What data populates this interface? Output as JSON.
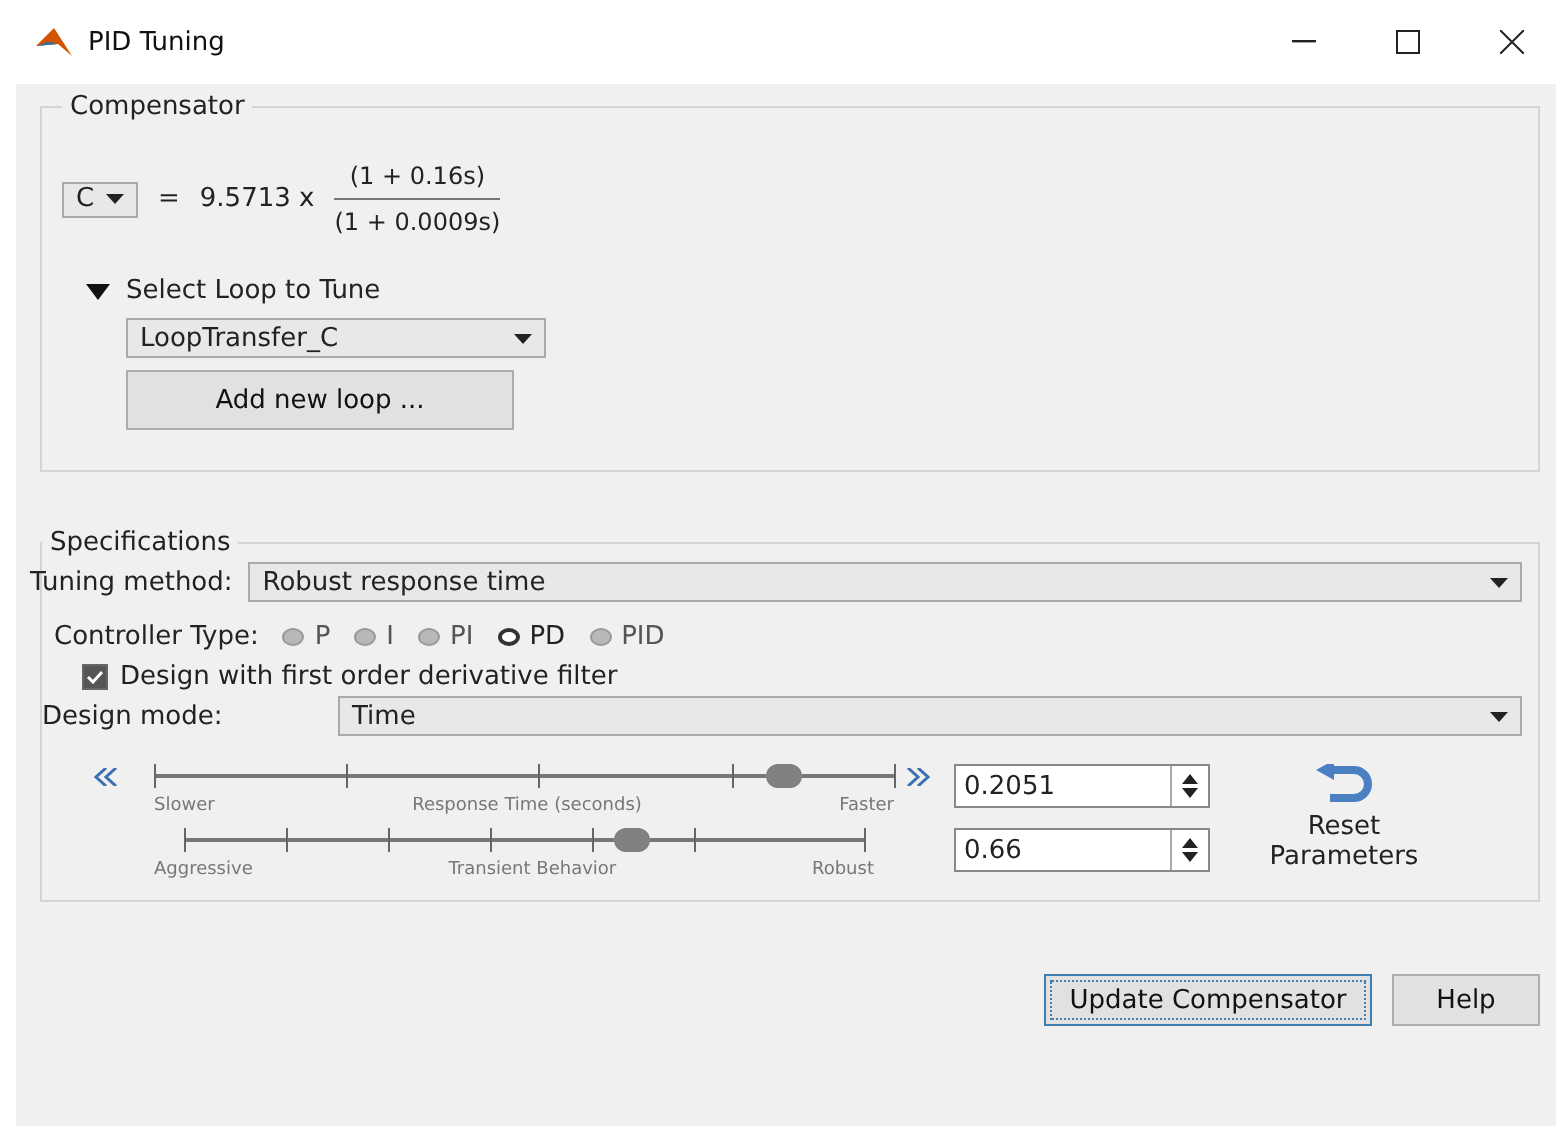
{
  "window": {
    "title": "PID Tuning"
  },
  "compensator": {
    "legend": "Compensator",
    "selector": "C",
    "equals": "=",
    "gain": "9.5713 x",
    "numerator": "(1 + 0.16s)",
    "denominator": "(1 + 0.0009s)",
    "loop_section": {
      "label": "Select Loop to Tune",
      "expanded": true,
      "loop": "LoopTransfer_C",
      "add_button": "Add new loop ..."
    }
  },
  "specifications": {
    "legend": "Specifications",
    "tuning_method": {
      "label": "Tuning method:",
      "value": "Robust response time"
    },
    "controller_type": {
      "label": "Controller Type:",
      "options": [
        {
          "label": "P",
          "selected": false,
          "disabled": true
        },
        {
          "label": "I",
          "selected": false,
          "disabled": true
        },
        {
          "label": "PI",
          "selected": false,
          "disabled": true
        },
        {
          "label": "PD",
          "selected": true,
          "disabled": false
        },
        {
          "label": "PID",
          "selected": false,
          "disabled": true
        }
      ]
    },
    "derivative_filter": {
      "label": "Design with first order derivative filter",
      "checked": true
    },
    "design_mode": {
      "label": "Design mode:",
      "value": "Time"
    },
    "sliders": [
      {
        "left": "Slower",
        "middle": "Response Time (seconds)",
        "right": "Faster",
        "level": 0.85,
        "value": "0.2051",
        "kind": "stepped"
      },
      {
        "left": "Aggressive",
        "middle": "Transient Behavior",
        "right": "Robust",
        "level": 0.66,
        "value": "0.66",
        "kind": "plain"
      }
    ],
    "reset_button": "Reset Parameters"
  },
  "buttons": [
    {
      "label": "Update Compensator",
      "kind": "default"
    },
    {
      "label": "Help",
      "kind": "normal"
    }
  ]
}
